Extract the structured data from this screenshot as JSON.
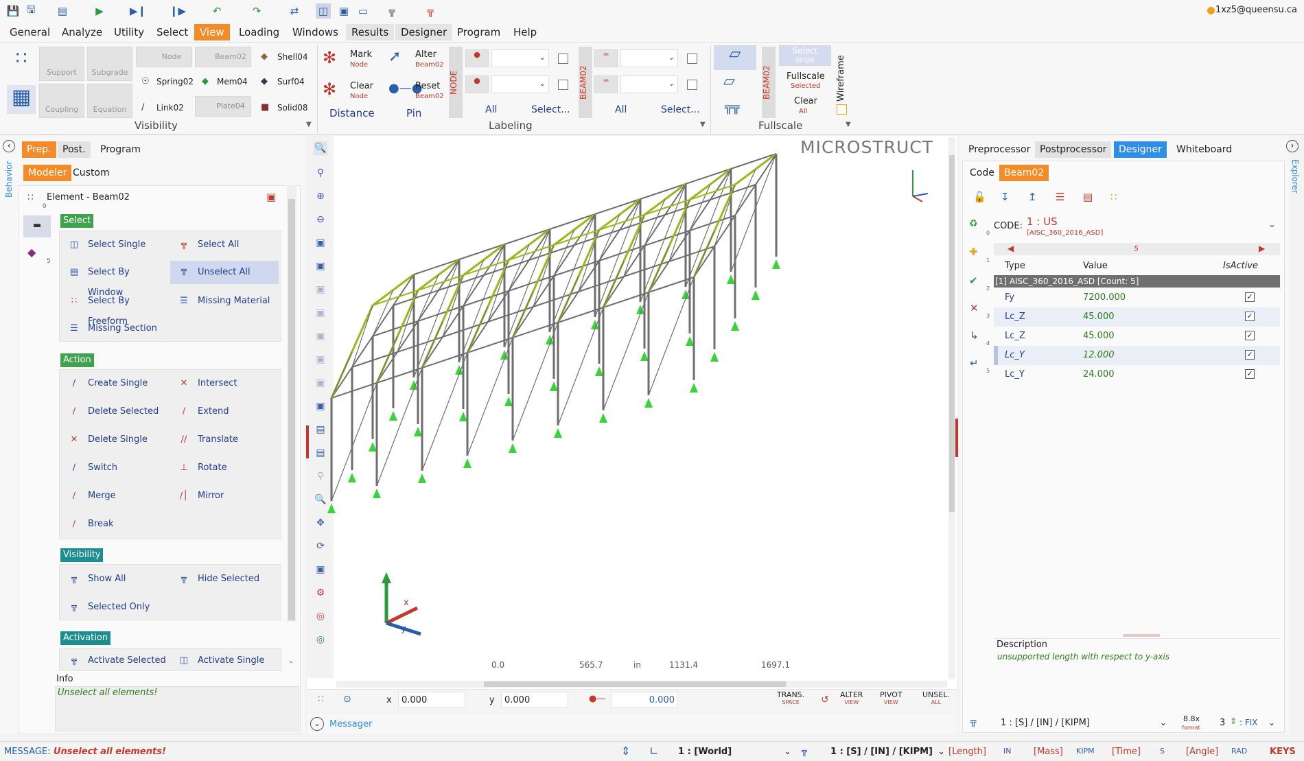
{
  "user": {
    "email": "1xz5@queensu.ca"
  },
  "menu": [
    "General",
    "Analyze",
    "Utility",
    "Select",
    "View",
    "Loading",
    "Windows",
    "Results",
    "Designer",
    "Program",
    "Help"
  ],
  "ribbon": {
    "visibility": {
      "buttons": [
        "Support",
        "Subgrade",
        "Coupling",
        "Equation",
        "Node",
        "Beam02",
        "Plate04"
      ],
      "items": [
        "Shell04",
        "Spring02",
        "Mem04",
        "Surf04",
        "Link02",
        "Solid08"
      ],
      "label": "Visibility"
    },
    "labeling": {
      "mark": "Mark",
      "mark_sub": "Node",
      "clear": "Clear",
      "clear_sub": "Node",
      "alter": "Alter",
      "alter_sub": "Beam02",
      "reset": "Reset",
      "reset_sub": "Beam02",
      "distance": "Distance",
      "pin": "Pin",
      "node_tag": "NODE",
      "beam_tag": "BEAM02",
      "all1": "All",
      "select1": "Select...",
      "all2": "All",
      "select2": "Select...",
      "label": "Labeling"
    },
    "fullscale": {
      "beam_tag": "BEAM02",
      "select": "Select",
      "select_sub": "Single",
      "fullscale": "Fullscale",
      "fullscale_sub": "Selected",
      "clear": "Clear",
      "clear_sub": "All",
      "wireframe": "Wireframe",
      "label": "Fullscale"
    }
  },
  "left": {
    "tabs": [
      "Prep.",
      "Post.",
      "Program"
    ],
    "subtabs": [
      "Modeler",
      "Custom"
    ],
    "side_label": "Behavior",
    "side_nums": [
      "0",
      "5"
    ],
    "element_title": "Element - Beam02",
    "sections": {
      "select": "Select",
      "action": "Action",
      "visibility": "Visibility",
      "activation": "Activation"
    },
    "select_cmds": [
      "Select Single",
      "Select All",
      "Select By Window",
      "Unselect All",
      "Select By Freeform",
      "Missing Material",
      "Missing Section"
    ],
    "action_cmds": [
      "Create Single",
      "Intersect",
      "Delete Selected",
      "Extend",
      "Delete Single",
      "Translate",
      "Switch",
      "Rotate",
      "Merge",
      "Mirror",
      "Break"
    ],
    "visibility_cmds": [
      "Show All",
      "Hide Selected",
      "Selected Only"
    ],
    "activation_cmds": [
      "Activate Selected",
      "Activate Single"
    ],
    "info_label": "Info",
    "info_text": "Unselect all elements!"
  },
  "viewport": {
    "brand": "MICROSTRUCT",
    "ruler": [
      "0.0",
      "565.7",
      "in",
      "1131.4",
      "1697.1"
    ],
    "x_label": "x",
    "x_value": "0.000",
    "y_label": "y",
    "y_value": "0.000",
    "z_value": "0.000",
    "modes": [
      {
        "top": "TRANS.",
        "sub": "SPACE"
      },
      {
        "top": "ALTER",
        "sub": "VIEW"
      },
      {
        "top": "PIVOT",
        "sub": "VIEW"
      },
      {
        "top": "UNSEL.",
        "sub": "ALL"
      }
    ],
    "messager": "Messager",
    "axis_x": "x",
    "axis_y": "y"
  },
  "right": {
    "tabs": [
      "Preprocessor",
      "Postprocessor",
      "Designer",
      "Whiteboard"
    ],
    "subtabs": [
      "Code",
      "Beam02"
    ],
    "side_label": "Explorer",
    "side_nums": [
      "0",
      "1",
      "2",
      "3",
      "4",
      "5"
    ],
    "code_label": "CODE:",
    "code_value": "1 : US",
    "code_sub": "[AISC_360_2016_ASD]",
    "pager": "5",
    "headers": [
      "Type",
      "Value",
      "IsActive"
    ],
    "group": "[1] AISC_360_2016_ASD   [Count: 5]",
    "rows": [
      {
        "type": "Fy",
        "value": "7200.000",
        "active": "✓"
      },
      {
        "type": "Lc_Z",
        "value": "45.000",
        "active": "✓"
      },
      {
        "type": "Lc_Z",
        "value": "45.000",
        "active": "✓"
      },
      {
        "type": "Lc_Y",
        "value": "12.000",
        "active": "✓"
      },
      {
        "type": "Lc_Y",
        "value": "24.000",
        "active": "✓"
      }
    ],
    "desc_label": "Description",
    "desc_text": "unsupported length with respect to y-axis",
    "units": "1 : [S] / [IN] / [KIPM]",
    "format_top": "8.8x",
    "format_sub": "format",
    "precision": "3",
    "fix": ": FIX"
  },
  "status": {
    "msg_label": "MESSAGE:",
    "msg_text": "Unselect all elements!",
    "world": "1 : [World]",
    "units": "1 : [S] / [IN] / [KIPM]",
    "length_label": "[Length]",
    "length_unit": "IN",
    "mass_label": "[Mass]",
    "mass_unit": "KIPM",
    "time_label": "[Time]",
    "time_unit": "S",
    "angle_label": "[Angle]",
    "angle_unit": "RAD",
    "keys": "KEYS"
  },
  "colors": {
    "accent": "#f28c28",
    "blue": "#2f8ee6",
    "green": "#3fa34d",
    "truss": "#9cb71e",
    "steel": "#6e6e6e"
  }
}
